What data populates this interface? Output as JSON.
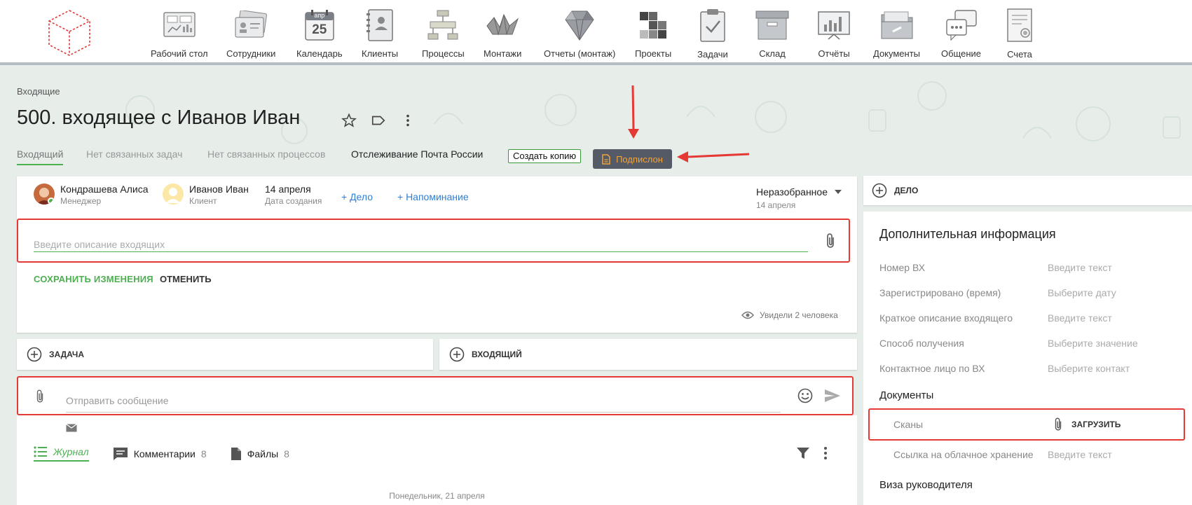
{
  "nav": {
    "items": [
      {
        "label": "Рабочий стол",
        "icon": "desktop-icon"
      },
      {
        "label": "Сотрудники",
        "icon": "employees-icon"
      },
      {
        "label": "Календарь",
        "icon": "calendar-icon",
        "cal_month": "апр",
        "cal_day": "25"
      },
      {
        "label": "Клиенты",
        "icon": "clients-icon"
      },
      {
        "label": "Процессы",
        "icon": "processes-icon"
      },
      {
        "label": "Монтажи",
        "icon": "installations-icon"
      },
      {
        "label": "Отчеты (монтаж)",
        "icon": "diamond-icon"
      },
      {
        "label": "Проекты",
        "icon": "projects-icon"
      },
      {
        "label": "Задачи",
        "icon": "tasks-icon"
      },
      {
        "label": "Склад",
        "icon": "warehouse-icon"
      },
      {
        "label": "Отчёты",
        "icon": "reports-icon"
      },
      {
        "label": "Документы",
        "icon": "documents-icon"
      },
      {
        "label": "Общение",
        "icon": "chat-icon"
      },
      {
        "label": "Счета",
        "icon": "invoices-icon"
      }
    ]
  },
  "header": {
    "breadcrumb": "Входящие",
    "title": "500. входящее с Иванов Иван",
    "tabs": [
      "Входящий",
      "Нет связанных задач",
      "Нет связанных процессов",
      "Отслеживание Почта России"
    ],
    "copy_button": "Создать копию",
    "podpislon_button": "Подпислон"
  },
  "main": {
    "manager": {
      "name": "Кондрашева Алиса",
      "role": "Менеджер"
    },
    "client": {
      "name": "Иванов Иван",
      "role": "Клиент"
    },
    "created": {
      "date": "14 апреля",
      "label": "Дата создания"
    },
    "add_deal": "+ Дело",
    "add_reminder": "+ Напоминание",
    "status": {
      "value": "Неразобранное",
      "date": "14 апреля"
    },
    "description_placeholder": "Введите описание входящих",
    "save_label": "СОХРАНИТЬ ИЗМЕНЕНИЯ",
    "cancel_label": "ОТМЕНИТЬ",
    "seen_label": "Увидели 2 человека"
  },
  "add_task_label": "ЗАДАЧА",
  "add_incoming_label": "ВХОДЯЩИЙ",
  "message": {
    "placeholder": "Отправить сообщение"
  },
  "journal": {
    "tabs": [
      {
        "label": "Журнал",
        "count": ""
      },
      {
        "label": "Комментарии",
        "count": "8"
      },
      {
        "label": "Файлы",
        "count": "8"
      }
    ],
    "day_label": "Понедельник, 21 апреля"
  },
  "right": {
    "add_deal_label": "ДЕЛО",
    "title": "Дополнительная информация",
    "fields": [
      {
        "label": "Номер ВХ",
        "value": "Введите текст"
      },
      {
        "label": "Зарегистрировано (время)",
        "value": "Выберите дату"
      },
      {
        "label": "Краткое описание входящего",
        "value": "Введите текст"
      },
      {
        "label": "Способ получения",
        "value": "Выберите значение"
      },
      {
        "label": "Контактное лицо по ВХ",
        "value": "Выберите контакт"
      }
    ],
    "documents_title": "Документы",
    "scans_label": "Сканы",
    "upload_label": "ЗАГРУЗИТЬ",
    "cloud_label": "Ссылка на облачное хранение",
    "cloud_value": "Введите текст",
    "visa_title": "Виза руководителя"
  },
  "colors": {
    "accent": "#4caf50",
    "link": "#2f7fd1",
    "highlight": "#e53935",
    "podpislon_bg": "#555b66",
    "podpislon_fg": "#f2a33a"
  }
}
